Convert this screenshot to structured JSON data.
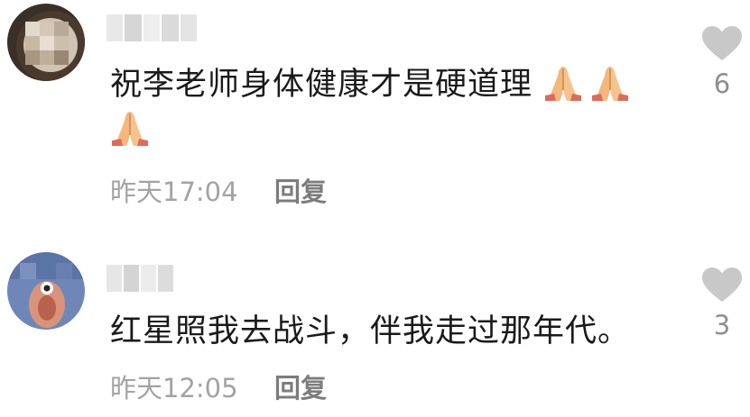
{
  "comments": [
    {
      "username": "",
      "text": "祝李老师身体健康才是硬道理",
      "emojis": [
        "folded-hands",
        "folded-hands",
        "folded-hands"
      ],
      "time": "昨天17:04",
      "reply_label": "回复",
      "likes": "6"
    },
    {
      "username": "",
      "text": "红星照我去战斗，伴我走过那年代。",
      "emojis": [],
      "time": "昨天12:05",
      "reply_label": "回复",
      "likes": "3"
    }
  ],
  "colors": {
    "text": "#1a1a1a",
    "time": "#a3a3a3",
    "reply": "#7c7c7c",
    "like_icon": "#c8c8c8",
    "like_count": "#8e8e8e"
  },
  "icons": {
    "like": "heart-icon",
    "emoji": "folded-hands-emoji"
  }
}
